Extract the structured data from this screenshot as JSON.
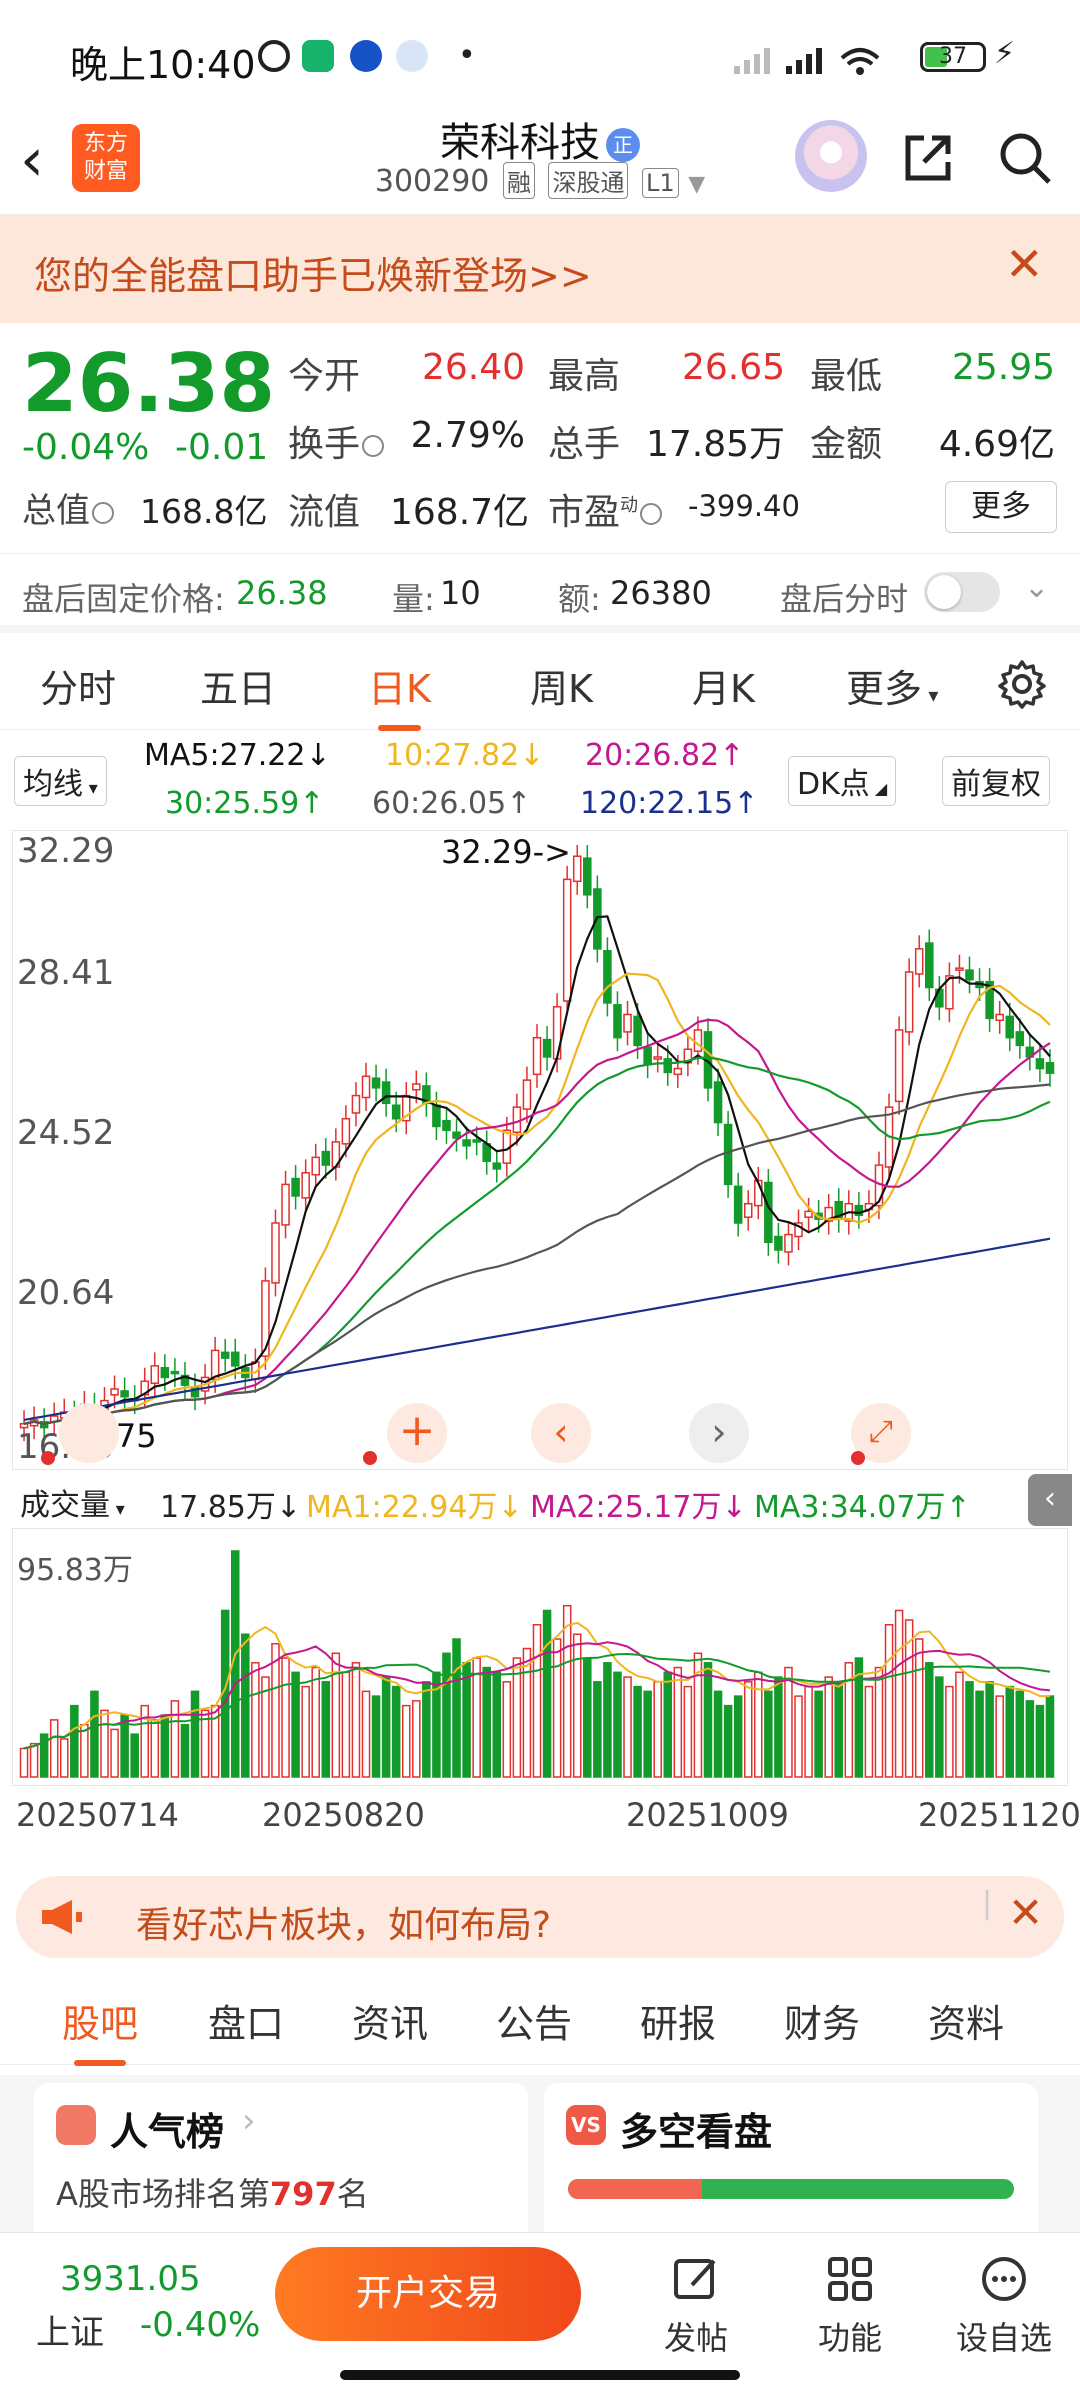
{
  "status_bar": {
    "time": "晚上10:40",
    "battery": "37"
  },
  "header": {
    "stock_name": "荣科科技",
    "badge": "正",
    "code": "300290",
    "tags": [
      "融",
      "深股通",
      "L1"
    ]
  },
  "banner": {
    "text": "您的全能盘口助手已焕新登场>>"
  },
  "quote": {
    "price": "26.38",
    "change_pct": "-0.04%",
    "change": "-0.01",
    "open_label": "今开",
    "open": "26.40",
    "high_label": "最高",
    "high": "26.65",
    "low_label": "最低",
    "low": "25.95",
    "turnover_label": "换手",
    "turnover": "2.79%",
    "volume_label": "总手",
    "volume": "17.85万",
    "amount_label": "金额",
    "amount": "4.69亿",
    "mcap_label": "总值",
    "mcap": "168.8亿",
    "float_label": "流值",
    "float": "168.7亿",
    "pe_label": "市盈",
    "pe_sup": "动",
    "pe": "-399.40",
    "more_label": "更多"
  },
  "after_hours": {
    "price_label": "盘后固定价格:",
    "price": "26.38",
    "qty_label": "量:",
    "qty": "10",
    "amt_label": "额:",
    "amt": "26380",
    "timeshare_label": "盘后分时"
  },
  "kline_tabs": [
    "分时",
    "五日",
    "日K",
    "周K",
    "月K",
    "更多"
  ],
  "kline_active": "日K",
  "ma_row": {
    "select": "均线",
    "ma5": "MA5:27.22↓",
    "ma10": "10:27.82↓",
    "ma20": "20:26.82↑",
    "ma30": "30:25.59↑",
    "ma60": "60:26.05↑",
    "ma120": "120:22.15↑",
    "dk": "DK点",
    "adjust": "前复权"
  },
  "colors": {
    "up": "#e2302f",
    "down": "#129b2b",
    "accent": "#f05a1f",
    "ma5": "#111111",
    "ma10": "#f0b620",
    "ma20": "#c4188e",
    "ma30": "#129b2b",
    "ma60": "#555555",
    "ma120": "#1b2f8f"
  },
  "chart_data": {
    "type": "line",
    "y_axis_ticks": [
      "32.29",
      "28.41",
      "24.52",
      "20.64",
      "16.75"
    ],
    "ylim": [
      16.75,
      32.29
    ],
    "annotations": [
      "32.29->",
      "16.75"
    ],
    "close": [
      17.3,
      17.4,
      17.2,
      17.5,
      17.6,
      17.5,
      17.8,
      17.7,
      17.9,
      18.2,
      18.0,
      17.9,
      18.4,
      18.8,
      18.5,
      18.6,
      18.3,
      18.0,
      18.5,
      19.2,
      19.0,
      18.8,
      18.5,
      18.9,
      21.0,
      22.5,
      23.5,
      23.2,
      23.8,
      24.2,
      24.0,
      24.6,
      25.2,
      25.8,
      26.3,
      26.0,
      25.6,
      25.2,
      25.8,
      26.1,
      25.6,
      25.0,
      24.9,
      24.7,
      24.5,
      24.6,
      24.1,
      23.9,
      24.9,
      25.5,
      26.2,
      27.3,
      26.8,
      28.1,
      31.4,
      32.0,
      31.0,
      29.6,
      28.2,
      27.3,
      27.9,
      27.1,
      26.6,
      26.8,
      26.4,
      26.5,
      27.0,
      27.5,
      26.0,
      25.1,
      23.5,
      22.5,
      23.0,
      23.6,
      22.0,
      21.8,
      22.2,
      22.5,
      22.8,
      22.6,
      22.9,
      22.6,
      23.0,
      22.7,
      23.0,
      24.0,
      25.5,
      27.5,
      29.0,
      29.6,
      28.6,
      28.1,
      28.9,
      29.1,
      28.8,
      28.6,
      27.8,
      27.9,
      27.3,
      27.1,
      26.8,
      26.5,
      26.38
    ],
    "volume_ylim": [
      0,
      95.83
    ],
    "volume_unit": "万",
    "volume": [
      12,
      14,
      18,
      24,
      16,
      30,
      22,
      36,
      28,
      20,
      26,
      18,
      30,
      24,
      26,
      32,
      22,
      36,
      28,
      30,
      70,
      95,
      60,
      48,
      42,
      56,
      50,
      44,
      38,
      46,
      40,
      52,
      44,
      48,
      36,
      34,
      42,
      38,
      30,
      32,
      40,
      44,
      52,
      58,
      48,
      50,
      46,
      44,
      40,
      50,
      54,
      64,
      70,
      58,
      72,
      60,
      50,
      40,
      48,
      44,
      42,
      38,
      36,
      40,
      44,
      46,
      38,
      52,
      48,
      36,
      30,
      34,
      40,
      44,
      36,
      42,
      46,
      34,
      38,
      36,
      42,
      40,
      48,
      50,
      38,
      46,
      64,
      70,
      66,
      58,
      48,
      42,
      38,
      44,
      40,
      36,
      40,
      34,
      38,
      36,
      32,
      30,
      34
    ],
    "volume_stats": {
      "label": "成交量",
      "value": "17.85万↓",
      "ma1": "MA1:22.94万↓",
      "ma2": "MA2:25.17万↓",
      "ma3": "MA3:34.07万↑"
    },
    "x_labels": [
      "20250714",
      "20250820",
      "20251009",
      "20251120"
    ]
  },
  "promo": {
    "text": "看好芯片板块，如何布局?"
  },
  "bottom_tabs": [
    "股吧",
    "盘口",
    "资讯",
    "公告",
    "研报",
    "财务",
    "资料"
  ],
  "bottom_active": "股吧",
  "cards": {
    "left_title": "人气榜",
    "left_sub_pre": "A股市场排名第",
    "left_rank": "797",
    "left_sub_post": "名",
    "right_title": "多空看盘"
  },
  "bottom_bar": {
    "index_value": "3931.05",
    "index_name": "上证",
    "index_change": "-0.40%",
    "open_account": "开户交易",
    "post": "发帖",
    "func": "功能",
    "watch": "设自选"
  }
}
